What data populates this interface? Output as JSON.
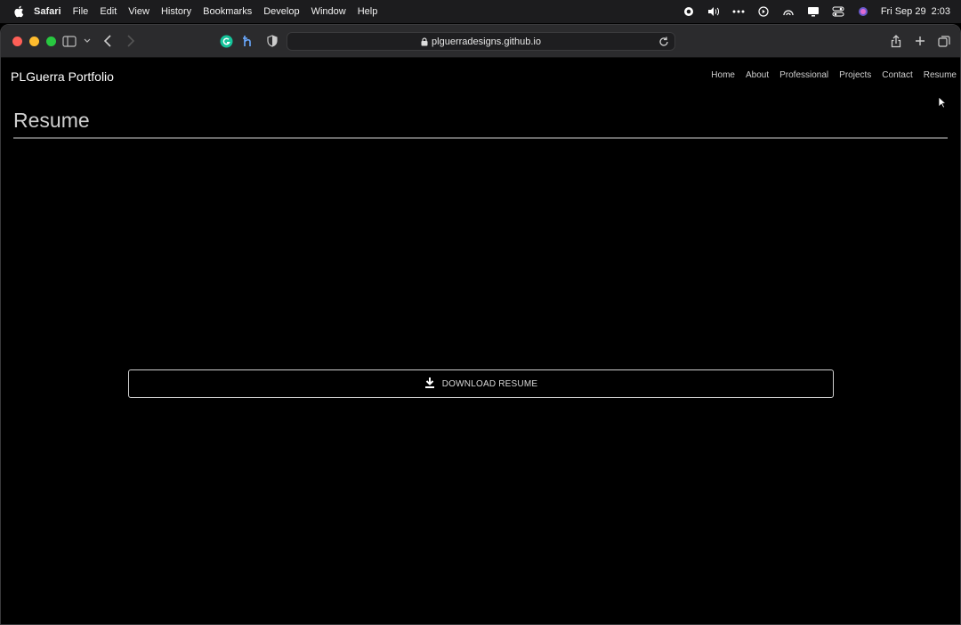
{
  "menubar": {
    "app": "Safari",
    "items": [
      "File",
      "Edit",
      "View",
      "History",
      "Bookmarks",
      "Develop",
      "Window",
      "Help"
    ],
    "date": "Fri Sep 29",
    "time": "2:03"
  },
  "browser": {
    "url": "plguerradesigns.github.io"
  },
  "page": {
    "site_title": "PLGuerra Portfolio",
    "nav": [
      "Home",
      "About",
      "Professional",
      "Projects",
      "Contact",
      "Resume"
    ],
    "heading": "Resume",
    "download_label": "DOWNLOAD RESUME"
  },
  "colors": {
    "background": "#000000",
    "menubar": "#1c1c1e",
    "toolbar": "#2b2b2d"
  }
}
